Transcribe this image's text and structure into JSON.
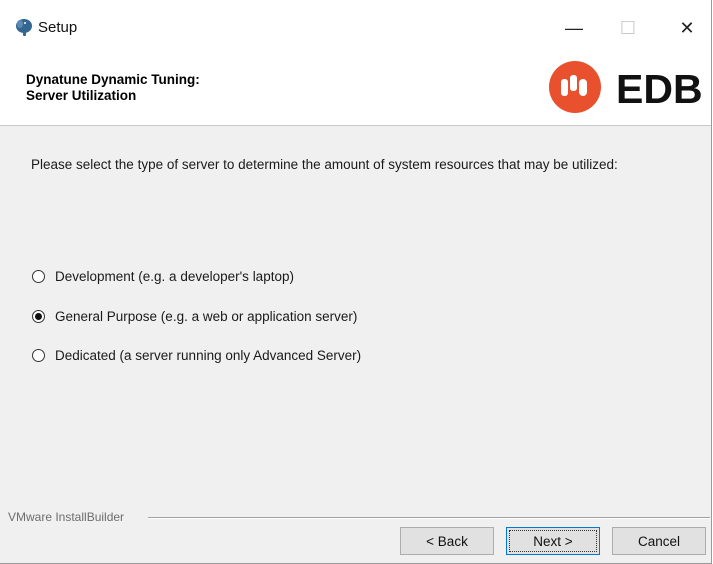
{
  "window": {
    "title": "Setup",
    "controls": {
      "minimize": "—",
      "maximize": "☐",
      "close": "✕"
    }
  },
  "header": {
    "title_line1": "Dynatune Dynamic Tuning:",
    "title_line2": "Server Utilization",
    "logo_text": "EDB",
    "logo_color": "#e8502e"
  },
  "main": {
    "instruction": "Please select the type of server to determine the amount of system resources that may be utilized:",
    "options": [
      {
        "label": "Development (e.g. a developer's laptop)",
        "selected": false
      },
      {
        "label": "General Purpose (e.g. a web or application server)",
        "selected": true
      },
      {
        "label": "Dedicated (a server running only Advanced Server)",
        "selected": false
      }
    ]
  },
  "footer": {
    "installer_label": "VMware InstallBuilder",
    "back_label": "< Back",
    "next_label": "Next >",
    "cancel_label": "Cancel"
  }
}
